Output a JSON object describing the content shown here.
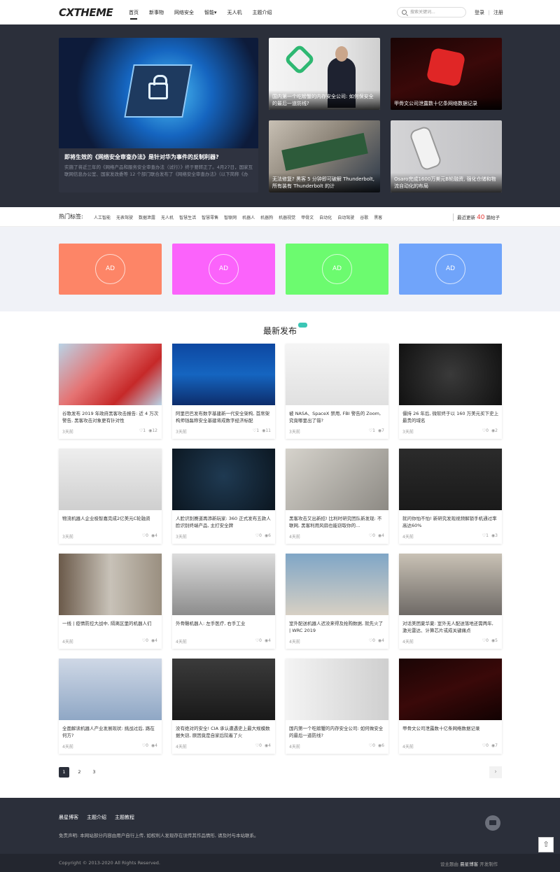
{
  "header": {
    "logo": "CXTHEME",
    "nav": [
      "首页",
      "新事物",
      "网络安全",
      "智能▾",
      "无人机",
      "主题介绍"
    ],
    "search_placeholder": "搜索关键词...",
    "login": "登录",
    "divider": "|",
    "register": "注册"
  },
  "hero": {
    "main": {
      "title": "即将生效的《网络安全审查办法》是针对华为事件的反制利器?",
      "desc": "实施了将近三年的《网络产品和服务安全审查办法（试行）》终于要转正了。4月27日，国家互联网信息办公室、国家发改委等 12 个部门联合发布了《网络安全审查办法》（以下简称《办"
    },
    "cards": [
      {
        "title": "国内第一个吃螃蟹的内存安全公司: 如何保安全的最后一道防线?"
      },
      {
        "title": "甲骨文公司泄露数十亿条网络数据记录"
      },
      {
        "title": "无法修复? 黑客 5 分钟即可破解 Thunderbolt, 所有装有 Thunderbolt 的计"
      },
      {
        "title": "Osaro完成1600万美元B轮融资, 强化仓储和物流自动化的布局"
      }
    ]
  },
  "tags": {
    "label": "热门标签:",
    "items": [
      "人工智能",
      "无表驾驶",
      "数据泄露",
      "无人机",
      "智慧生活",
      "智慧零售",
      "智联网",
      "机器人",
      "机器狗",
      "机器视觉",
      "甲骨文",
      "自动化",
      "自动驾驶",
      "谷歌",
      "黑客"
    ],
    "update_prefix": "最近更新",
    "update_count": "40",
    "update_suffix": "篇帖子"
  },
  "ads": [
    {
      "label": "AD",
      "color": "#fd8567"
    },
    {
      "label": "AD",
      "color": "#fb63fb"
    },
    {
      "label": "AD",
      "color": "#6cfb6f"
    },
    {
      "label": "AD",
      "color": "#70a4fa"
    }
  ],
  "latest": {
    "title": "最新发布",
    "posts": [
      {
        "title": "谷歌发布 2019 年政府黑客攻击报告: 近 4 万次警告, 黑客攻击对象更有针对性",
        "date": "3天前",
        "likes": "1",
        "views": "12"
      },
      {
        "title": "阿里巴巴发布数字基建新一代安全架构, 首席架构师钱磊称安全基建将成数字经济标配",
        "date": "3天前",
        "likes": "1",
        "views": "11"
      },
      {
        "title": "被 NASA、SpaceX 禁用, FBI 警告的 Zoom, 究竟哪里出了错?",
        "date": "3天前",
        "likes": "1",
        "views": "7"
      },
      {
        "title": "僵持 26 年后, 微软终于以 160 万美元买下史上最贵的域名",
        "date": "3天前",
        "likes": "0",
        "views": "2"
      },
      {
        "title": "物流机器人企业极智嘉完成2亿美元C轮融资",
        "date": "3天前",
        "likes": "0",
        "views": "4"
      },
      {
        "title": "人脸识别赛道再添新玩家: 360 正式发布五款人脸识别终端产品, 主打安全牌",
        "date": "3天前",
        "likes": "0",
        "views": "6"
      },
      {
        "title": "黑客攻击又出新招! 比利时研究团队新发现: 不联网, 黑客利用风扇也能窃取你的...",
        "date": "4天前",
        "likes": "0",
        "views": "4"
      },
      {
        "title": "就问你怕不怕! 新研究发现视频解锁手机通过率高达60%",
        "date": "4天前",
        "likes": "1",
        "views": "3"
      },
      {
        "title": "一线 | 疫情防控大战中, 隔离区里的机器人们",
        "date": "4天前",
        "likes": "0",
        "views": "4"
      },
      {
        "title": "外骨骼机器人: 左手医疗, 右手工业",
        "date": "4天前",
        "likes": "0",
        "views": "4"
      },
      {
        "title": "室外配送机器人迟没来得及抢购数据, 就先火了 | WRC 2019",
        "date": "4天前",
        "likes": "0",
        "views": "4"
      },
      {
        "title": "对话美团夏华夏: 室外无人配送落地还需两年, 激光雷达、计算芯片或成关键痛点",
        "date": "4天前",
        "likes": "0",
        "views": "5"
      },
      {
        "title": "全面解读机器人产业发展现状: 挑战过后, 路在何方?",
        "date": "4天前",
        "likes": "0",
        "views": "4"
      },
      {
        "title": "没有绝对的安全! CIA 承认遭遇史上最大规模数据失窃, 原因竟是自家后院着了火",
        "date": "4天前",
        "likes": "0",
        "views": "4"
      },
      {
        "title": "国内第一个吃螃蟹的内存安全公司: 如何做安全的最后一道防线?",
        "date": "4天前",
        "likes": "0",
        "views": "6"
      },
      {
        "title": "甲骨文公司泄露数十亿条网络数据记录",
        "date": "4天前",
        "likes": "0",
        "views": "7"
      }
    ]
  },
  "pagination": {
    "pages": [
      "1",
      "2",
      "3"
    ],
    "next": "›"
  },
  "footer": {
    "links": [
      "晨星博客",
      "主题介绍",
      "主题教程"
    ],
    "disclaimer": "免责声明: 本网站部分内容由用户自行上传, 如权利人发现存在误传其作品情形, 请及时与本站联系。",
    "copyright": "Copyright © 2013-2020 All Rights Reserved.",
    "powered_prefix": "设主题由",
    "powered_name": "晨星博客",
    "powered_suffix": "开发制作",
    "totop": "⇧"
  }
}
